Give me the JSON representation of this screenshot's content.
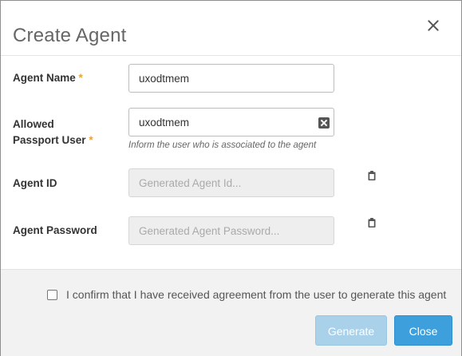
{
  "dialog": {
    "title": "Create Agent"
  },
  "form": {
    "agent_name": {
      "label": "Agent Name",
      "required_marker": "*",
      "value": "uxodtmem"
    },
    "passport_user": {
      "label_line1": "Allowed",
      "label_line2": "Passport User",
      "required_marker": "*",
      "value": "uxodtmem",
      "help_text": "Inform the user who is associated to the agent"
    },
    "agent_id": {
      "label": "Agent ID",
      "placeholder": "Generated Agent Id..."
    },
    "agent_password": {
      "label": "Agent Password",
      "placeholder": "Generated Agent Password..."
    }
  },
  "footer": {
    "confirm_text": "I confirm that I have received agreement from the user to generate this agent",
    "confirm_checked": false,
    "generate_label": "Generate",
    "close_label": "Close"
  },
  "colors": {
    "accent": "#3d9fdb",
    "accent_disabled": "#a9d1ea",
    "required": "#e8a33a"
  },
  "icons": {
    "close": "close-icon",
    "clear": "clear-input-icon",
    "copy": "clipboard-icon"
  }
}
